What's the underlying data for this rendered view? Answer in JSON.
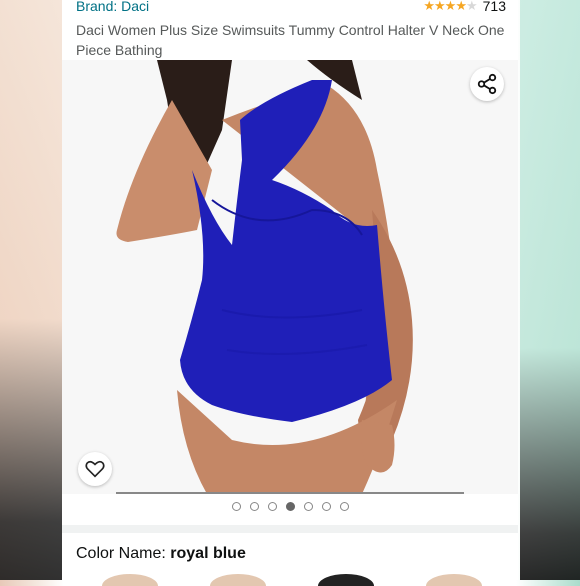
{
  "product": {
    "brand": "Brand: Daci",
    "rating_count": "713",
    "rating_value": 4.2,
    "title": "Daci Women Plus Size Swimsuits Tummy Control Halter V Neck One Piece Bathing"
  },
  "gallery": {
    "image_count": 7,
    "active_index": 3,
    "swimsuit_color": "#1f1fb8",
    "icons": {
      "share": "share-icon",
      "wishlist": "heart-outline-icon"
    }
  },
  "variant": {
    "label": "Color Name:",
    "value": "royal blue"
  },
  "colors": {
    "link": "#007185",
    "star": "#f5a623"
  }
}
